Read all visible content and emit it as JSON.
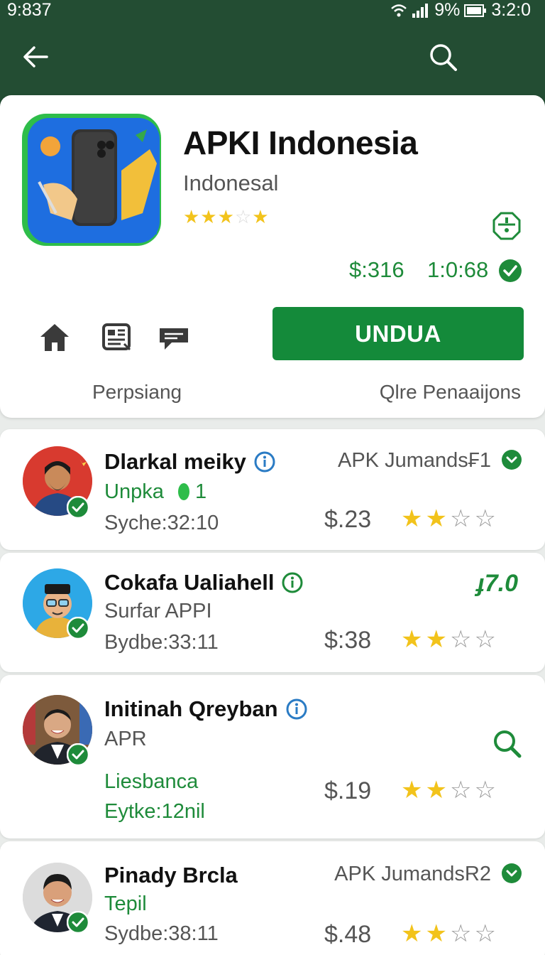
{
  "status": {
    "time": "9:837",
    "battery": "9%",
    "clock": "3:2:0"
  },
  "app": {
    "title": "APKI Indonesia",
    "developer": "Indonesal",
    "rating_stars": 3,
    "price": "$:316",
    "count": "1:0:68",
    "install_label": "UNDUA",
    "footer_left": "Perpsiang",
    "footer_right": "Qlre Penaaijons"
  },
  "colors": {
    "appbar": "#234d33",
    "accent": "#148a3a",
    "green_text": "#1e8b3a",
    "star": "#f2c31b"
  },
  "items": [
    {
      "name": "Dlarkal meiky",
      "sub": "Unpka",
      "sub_suffix": "1",
      "meta": "Syche:32:10",
      "price": "$.23",
      "stars": 2,
      "tag": "APK Jumands₣1"
    },
    {
      "name": "Cokafa Ualiahell",
      "sub": "Surfar APPI",
      "meta": "Bydbe:33:11",
      "price": "$:38",
      "stars": 2,
      "score": "ɟ7.0"
    },
    {
      "name": "Initinah Qreyban",
      "sub": "APR",
      "sub2": "Liesbanca",
      "meta": "Eytke:12nil",
      "price": "$.19",
      "stars": 2
    },
    {
      "name": "Pinady Brcla",
      "sub": "Tepil",
      "meta": "Sydbe:38:11",
      "price": "$.48",
      "stars": 2,
      "tag": "APK JumandsR2"
    }
  ]
}
